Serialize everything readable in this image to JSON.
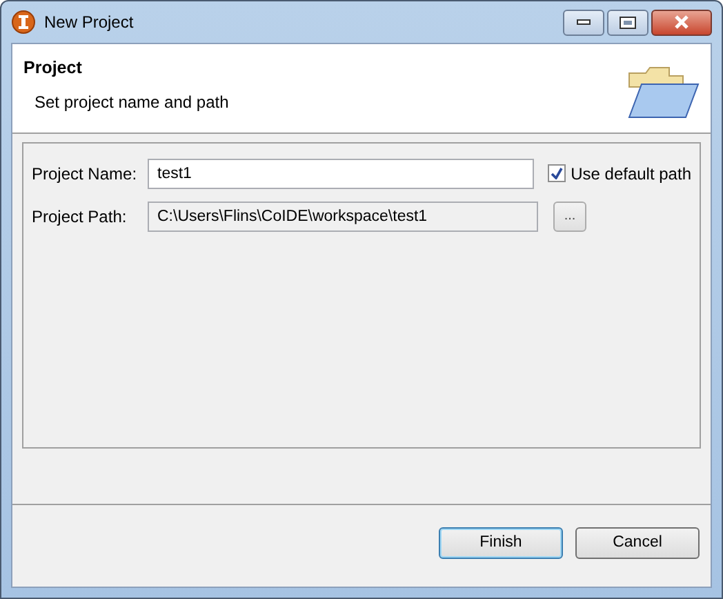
{
  "window": {
    "title": "New Project"
  },
  "header": {
    "title": "Project",
    "description": "Set project name and path"
  },
  "fields": [
    {
      "label": "Project Name:",
      "value": "test1",
      "disabled": false
    },
    {
      "label": "Project Path:",
      "value": "C:\\Users\\Flins\\CoIDE\\workspace\\test1",
      "disabled": true
    }
  ],
  "default_path": {
    "label": "Use default path",
    "checked": true
  },
  "browse_button": "...",
  "buttons": [
    {
      "label": "Finish",
      "default": true
    },
    {
      "label": "Cancel",
      "default": false
    }
  ]
}
